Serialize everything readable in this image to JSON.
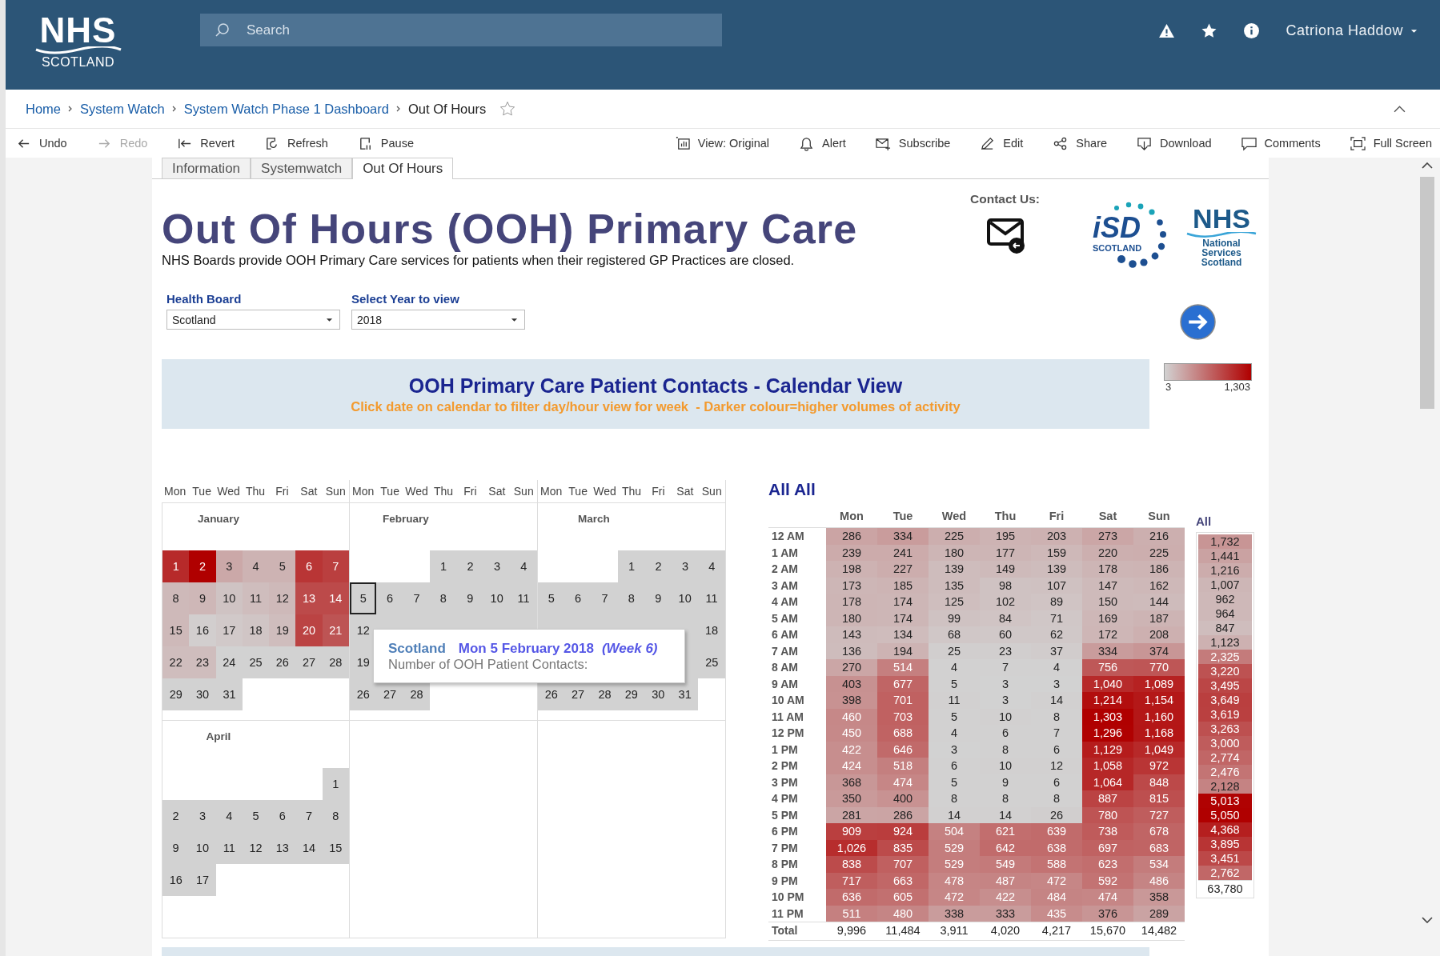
{
  "header": {
    "logo": {
      "top": "NHS",
      "bottom": "SCOTLAND"
    },
    "search": {
      "placeholder": "Search"
    },
    "user": "Catriona Haddow"
  },
  "breadcrumb": [
    {
      "label": "Home",
      "current": false
    },
    {
      "label": "System Watch",
      "current": false
    },
    {
      "label": "System Watch Phase 1 Dashboard",
      "current": false
    },
    {
      "label": "Out Of Hours",
      "current": true
    }
  ],
  "toolbar": {
    "left": [
      {
        "kind": "undo",
        "label": "Undo",
        "disabled": false
      },
      {
        "kind": "redo",
        "label": "Redo",
        "disabled": true
      },
      {
        "kind": "revert",
        "label": "Revert",
        "disabled": false
      },
      {
        "kind": "refresh",
        "label": "Refresh",
        "disabled": false
      },
      {
        "kind": "pause",
        "label": "Pause",
        "disabled": false
      }
    ],
    "right": [
      {
        "kind": "view",
        "label": "View: Original",
        "disabled": false
      },
      {
        "kind": "alert",
        "label": "Alert",
        "disabled": false
      },
      {
        "kind": "subscribe",
        "label": "Subscribe",
        "disabled": false
      },
      {
        "kind": "edit",
        "label": "Edit",
        "disabled": false
      },
      {
        "kind": "share",
        "label": "Share",
        "disabled": false
      },
      {
        "kind": "download",
        "label": "Download",
        "disabled": false
      },
      {
        "kind": "comments",
        "label": "Comments",
        "disabled": false
      },
      {
        "kind": "fullscreen",
        "label": "Full Screen",
        "disabled": false
      }
    ]
  },
  "tabs": [
    {
      "label": "Information",
      "selected": false
    },
    {
      "label": "Systemwatch",
      "selected": false
    },
    {
      "label": "Out Of Hours",
      "selected": true
    }
  ],
  "dashboard": {
    "title": "Out Of Hours (OOH) Primary Care",
    "subtitle": "NHS Boards provide OOH Primary Care services for patients when their registered GP Practices are closed.",
    "contact": "Contact Us:",
    "isd_logo": {
      "mark": "iSD",
      "name": "SCOTLAND"
    },
    "nss_logo": {
      "top": "NHS",
      "lines": [
        "National",
        "Services",
        "Scotland"
      ]
    },
    "filters": [
      {
        "label": "Health Board",
        "value": "Scotland"
      },
      {
        "label": "Select Year to view",
        "value": "2018"
      }
    ],
    "banner": {
      "title": "OOH Primary Care Patient Contacts - Calendar View",
      "subtitle": "Click date on calendar to filter day/hour view for week  - Darker colour=higher volumes of activity"
    },
    "legend": {
      "min": "3",
      "max": "1,303"
    }
  },
  "calendar": {
    "columns": [
      {
        "weekdays": [
          "Mon",
          "Tue",
          "Wed",
          "Thu",
          "Fri",
          "Sat",
          "Sun"
        ]
      },
      {
        "weekdays": [
          "Mon",
          "Tue",
          "Wed",
          "Thu",
          "Fri",
          "Sat",
          "Sun"
        ]
      },
      {
        "weekdays": [
          "Mon",
          "Tue",
          "Wed",
          "Thu",
          "Fri",
          "Sat",
          "Sun"
        ]
      }
    ],
    "months": [
      {
        "name": "January",
        "weeks": [
          {
            "kind": "lead",
            "days": [
              {
                "day": "1",
                "color": "#b72a2a",
                "selected": false
              },
              {
                "day": "2",
                "color": "#b00000",
                "selected": false
              },
              {
                "day": "3",
                "color": "#cba8a8",
                "selected": false
              },
              {
                "day": "4",
                "color": "#cdb3b3",
                "selected": false
              },
              {
                "day": "5",
                "color": "#cdb3b3",
                "selected": false
              },
              {
                "day": "6",
                "color": "#b93535",
                "selected": false
              },
              {
                "day": "7",
                "color": "#ba3f3f",
                "selected": false
              }
            ]
          },
          {
            "kind": "tail",
            "days": [
              {
                "day": "8",
                "color": "#ceb9b9",
                "selected": false
              },
              {
                "day": "9",
                "color": "#ceb7b7",
                "selected": false
              },
              {
                "day": "10",
                "color": "#cfc3c3",
                "selected": false
              },
              {
                "day": "11",
                "color": "#cfbdbd",
                "selected": false
              },
              {
                "day": "12",
                "color": "#ceb9b9",
                "selected": false
              },
              {
                "day": "13",
                "color": "#bc4a4a",
                "selected": false
              },
              {
                "day": "14",
                "color": "#bc4a4a",
                "selected": false
              }
            ]
          },
          {
            "kind": "tail",
            "days": [
              {
                "day": "15",
                "color": "#ceb9b9",
                "selected": false
              },
              {
                "day": "16",
                "color": "#d2cece",
                "selected": false
              },
              {
                "day": "17",
                "color": "#d1c9c9",
                "selected": false
              },
              {
                "day": "18",
                "color": "#d0c5c5",
                "selected": false
              },
              {
                "day": "19",
                "color": "#cfbdbd",
                "selected": false
              },
              {
                "day": "20",
                "color": "#bb4343",
                "selected": false
              },
              {
                "day": "21",
                "color": "#bd5454",
                "selected": false
              }
            ]
          },
          {
            "kind": "tail",
            "days": [
              {
                "day": "22",
                "color": "#cfbdbd",
                "selected": false
              },
              {
                "day": "23",
                "color": "#cfbdbd",
                "selected": false
              },
              {
                "day": "24",
                "color": "#d2d2d2",
                "selected": false
              },
              {
                "day": "25",
                "color": "#d2d2d2",
                "selected": false
              },
              {
                "day": "26",
                "color": "#d2d2d2",
                "selected": false
              },
              {
                "day": "27",
                "color": "#d2d2d2",
                "selected": false
              },
              {
                "day": "28",
                "color": "#d2d2d2",
                "selected": false
              }
            ]
          },
          {
            "kind": "tail",
            "days": [
              {
                "day": "29",
                "color": "#d2d2d2",
                "selected": false
              },
              {
                "day": "30",
                "color": "#d2d2d2",
                "selected": false
              },
              {
                "day": "31",
                "color": "#d2d2d2",
                "selected": false
              }
            ]
          }
        ]
      },
      {
        "name": "February",
        "weeks": [
          {
            "kind": "lead",
            "days": [
              {
                "day": "1",
                "color": "#d2d2d2",
                "selected": false
              },
              {
                "day": "2",
                "color": "#d2d2d2",
                "selected": false
              },
              {
                "day": "3",
                "color": "#d2d2d2",
                "selected": false
              },
              {
                "day": "4",
                "color": "#d2d2d2",
                "selected": false
              }
            ]
          },
          {
            "kind": "tail",
            "days": [
              {
                "day": "5",
                "color": "#d2d2d2",
                "selected": true
              },
              {
                "day": "6",
                "color": "#d2d2d2",
                "selected": false
              },
              {
                "day": "7",
                "color": "#d2d2d2",
                "selected": false
              },
              {
                "day": "8",
                "color": "#d2d2d2",
                "selected": false
              },
              {
                "day": "9",
                "color": "#d2d2d2",
                "selected": false
              },
              {
                "day": "10",
                "color": "#d2d2d2",
                "selected": false
              },
              {
                "day": "11",
                "color": "#d2d2d2",
                "selected": false
              }
            ]
          },
          {
            "kind": "tail",
            "days": [
              {
                "day": "12",
                "color": "#d2d2d2",
                "selected": false
              },
              {
                "color": "#d2d2d2",
                "selected": false
              },
              {
                "color": "#d2d2d2",
                "selected": false
              },
              {
                "color": "#d2d2d2",
                "selected": false
              },
              {
                "color": "#d2d2d2",
                "selected": false
              },
              {
                "color": "#d2d2d2",
                "selected": false
              },
              {
                "color": "#d2d2d2",
                "selected": false
              }
            ]
          },
          {
            "kind": "tail",
            "days": [
              {
                "day": "19",
                "color": "#d2d2d2",
                "selected": false
              }
            ]
          },
          {
            "kind": "tail",
            "days": [
              {
                "day": "26",
                "color": "#d2d2d2",
                "selected": false
              },
              {
                "day": "27",
                "color": "#d2d2d2",
                "selected": false
              },
              {
                "day": "28",
                "color": "#d2d2d2",
                "selected": false
              }
            ]
          }
        ]
      },
      {
        "name": "March",
        "weeks": [
          {
            "kind": "lead",
            "days": [
              {
                "day": "1",
                "color": "#d2d2d2",
                "selected": false
              },
              {
                "day": "2",
                "color": "#d2d2d2",
                "selected": false
              },
              {
                "day": "3",
                "color": "#d2d2d2",
                "selected": false
              },
              {
                "day": "4",
                "color": "#d2d2d2",
                "selected": false
              }
            ]
          },
          {
            "kind": "tail",
            "days": [
              {
                "day": "5",
                "color": "#d2d2d2",
                "selected": false
              },
              {
                "day": "6",
                "color": "#d2d2d2",
                "selected": false
              },
              {
                "day": "7",
                "color": "#d2d2d2",
                "selected": false
              },
              {
                "day": "8",
                "color": "#d2d2d2",
                "selected": false
              },
              {
                "day": "9",
                "color": "#d2d2d2",
                "selected": false
              },
              {
                "day": "10",
                "color": "#d2d2d2",
                "selected": false
              },
              {
                "day": "11",
                "color": "#d2d2d2",
                "selected": false
              }
            ]
          },
          {
            "kind": "tail",
            "days": [
              {
                "color": "#d2d2d2",
                "selected": false
              },
              {
                "color": "#d2d2d2",
                "selected": false
              },
              {
                "color": "#d2d2d2",
                "selected": false
              },
              {
                "color": "#d2d2d2",
                "selected": false
              },
              {
                "color": "#d2d2d2",
                "selected": false
              },
              {
                "color": "#d2d2d2",
                "selected": false
              },
              {
                "day": "18",
                "color": "#d2d2d2",
                "selected": false
              }
            ]
          },
          {
            "kind": "lead",
            "days": [
              {
                "color": "#d2d2d2",
                "selected": false
              },
              {
                "day": "25",
                "color": "#d2d2d2",
                "selected": false
              }
            ]
          },
          {
            "kind": "tail",
            "days": [
              {
                "day": "26",
                "color": "#d2d2d2",
                "selected": false
              },
              {
                "day": "27",
                "color": "#d2d2d2",
                "selected": false
              },
              {
                "day": "28",
                "color": "#d2d2d2",
                "selected": false
              },
              {
                "day": "29",
                "color": "#d2d2d2",
                "selected": false
              },
              {
                "day": "30",
                "color": "#d2d2d2",
                "selected": false
              },
              {
                "day": "31",
                "color": "#d2d2d2",
                "selected": false
              }
            ]
          }
        ]
      },
      {
        "name": "April",
        "weeks": [
          {
            "kind": "lead",
            "days": [
              {
                "day": "1",
                "color": "#d2d2d2",
                "selected": false
              }
            ]
          },
          {
            "kind": "tail",
            "days": [
              {
                "day": "2",
                "color": "#d2d2d2",
                "selected": false
              },
              {
                "day": "3",
                "color": "#d2d2d2",
                "selected": false
              },
              {
                "day": "4",
                "color": "#d2d2d2",
                "selected": false
              },
              {
                "day": "5",
                "color": "#d2d2d2",
                "selected": false
              },
              {
                "day": "6",
                "color": "#d2d2d2",
                "selected": false
              },
              {
                "day": "7",
                "color": "#d2d2d2",
                "selected": false
              },
              {
                "day": "8",
                "color": "#d2d2d2",
                "selected": false
              }
            ]
          },
          {
            "kind": "tail",
            "days": [
              {
                "day": "9",
                "color": "#d2d2d2",
                "selected": false
              },
              {
                "day": "10",
                "color": "#d2d2d2",
                "selected": false
              },
              {
                "day": "11",
                "color": "#d2d2d2",
                "selected": false
              },
              {
                "day": "12",
                "color": "#d2d2d2",
                "selected": false
              },
              {
                "day": "13",
                "color": "#d2d2d2",
                "selected": false
              },
              {
                "day": "14",
                "color": "#d2d2d2",
                "selected": false
              },
              {
                "day": "15",
                "color": "#d2d2d2",
                "selected": false
              }
            ]
          },
          {
            "kind": "tail",
            "days": [
              {
                "day": "16",
                "color": "#d2d2d2",
                "selected": false
              },
              {
                "day": "17",
                "color": "#d2d2d2",
                "selected": false
              }
            ]
          }
        ]
      }
    ],
    "tooltip": {
      "place": "Scotland",
      "date": "Mon 5 February 2018",
      "week": "(Week 6)",
      "label": "Number of OOH Patient Contacts:"
    }
  },
  "heatmap": {
    "title": "All All",
    "columns": [
      "Mon",
      "Tue",
      "Wed",
      "Thu",
      "Fri",
      "Sat",
      "Sun"
    ],
    "all_label": "All",
    "rows": [
      {
        "hour": "12 AM",
        "values": [
          "286",
          "334",
          "225",
          "195",
          "203",
          "273",
          "216"
        ],
        "total": "1,732"
      },
      {
        "hour": "1 AM",
        "values": [
          "239",
          "241",
          "180",
          "177",
          "159",
          "220",
          "225"
        ],
        "total": "1,441"
      },
      {
        "hour": "2 AM",
        "values": [
          "198",
          "227",
          "139",
          "149",
          "139",
          "178",
          "186"
        ],
        "total": "1,216"
      },
      {
        "hour": "3 AM",
        "values": [
          "173",
          "185",
          "135",
          "98",
          "107",
          "147",
          "162"
        ],
        "total": "1,007"
      },
      {
        "hour": "4 AM",
        "values": [
          "178",
          "174",
          "125",
          "102",
          "89",
          "150",
          "144"
        ],
        "total": "962"
      },
      {
        "hour": "5 AM",
        "values": [
          "180",
          "174",
          "99",
          "84",
          "71",
          "169",
          "187"
        ],
        "total": "964"
      },
      {
        "hour": "6 AM",
        "values": [
          "143",
          "134",
          "68",
          "60",
          "62",
          "172",
          "208"
        ],
        "total": "847"
      },
      {
        "hour": "7 AM",
        "values": [
          "136",
          "194",
          "25",
          "23",
          "37",
          "334",
          "374"
        ],
        "total": "1,123"
      },
      {
        "hour": "8 AM",
        "values": [
          "270",
          "514",
          "4",
          "7",
          "4",
          "756",
          "770"
        ],
        "total": "2,325"
      },
      {
        "hour": "9 AM",
        "values": [
          "403",
          "677",
          "5",
          "3",
          "3",
          "1,040",
          "1,089"
        ],
        "total": "3,220"
      },
      {
        "hour": "10 AM",
        "values": [
          "398",
          "701",
          "11",
          "3",
          "14",
          "1,214",
          "1,154"
        ],
        "total": "3,495"
      },
      {
        "hour": "11 AM",
        "values": [
          "460",
          "703",
          "5",
          "10",
          "8",
          "1,303",
          "1,160"
        ],
        "total": "3,649"
      },
      {
        "hour": "12 PM",
        "values": [
          "450",
          "688",
          "4",
          "6",
          "7",
          "1,296",
          "1,168"
        ],
        "total": "3,619"
      },
      {
        "hour": "1 PM",
        "values": [
          "422",
          "646",
          "3",
          "8",
          "6",
          "1,129",
          "1,049"
        ],
        "total": "3,263"
      },
      {
        "hour": "2 PM",
        "values": [
          "424",
          "518",
          "6",
          "10",
          "12",
          "1,058",
          "972"
        ],
        "total": "3,000"
      },
      {
        "hour": "3 PM",
        "values": [
          "368",
          "474",
          "5",
          "9",
          "6",
          "1,064",
          "848"
        ],
        "total": "2,774"
      },
      {
        "hour": "4 PM",
        "values": [
          "350",
          "400",
          "8",
          "8",
          "8",
          "887",
          "815"
        ],
        "total": "2,476"
      },
      {
        "hour": "5 PM",
        "values": [
          "281",
          "286",
          "14",
          "14",
          "26",
          "780",
          "727"
        ],
        "total": "2,128"
      },
      {
        "hour": "6 PM",
        "values": [
          "909",
          "924",
          "504",
          "621",
          "639",
          "738",
          "678"
        ],
        "total": "5,013"
      },
      {
        "hour": "7 PM",
        "values": [
          "1,026",
          "835",
          "529",
          "642",
          "638",
          "697",
          "683"
        ],
        "total": "5,050"
      },
      {
        "hour": "8 PM",
        "values": [
          "838",
          "707",
          "529",
          "549",
          "588",
          "623",
          "534"
        ],
        "total": "4,368"
      },
      {
        "hour": "9 PM",
        "values": [
          "717",
          "663",
          "478",
          "487",
          "472",
          "592",
          "486"
        ],
        "total": "3,895"
      },
      {
        "hour": "10 PM",
        "values": [
          "636",
          "605",
          "472",
          "422",
          "484",
          "474",
          "358"
        ],
        "total": "3,451"
      },
      {
        "hour": "11 PM",
        "values": [
          "511",
          "480",
          "338",
          "333",
          "435",
          "376",
          "289"
        ],
        "total": "2,762"
      }
    ],
    "totals": {
      "label": "Total",
      "values": [
        "9,996",
        "11,484",
        "3,911",
        "4,020",
        "4,217",
        "15,670",
        "14,482"
      ],
      "total": "63,780"
    }
  }
}
